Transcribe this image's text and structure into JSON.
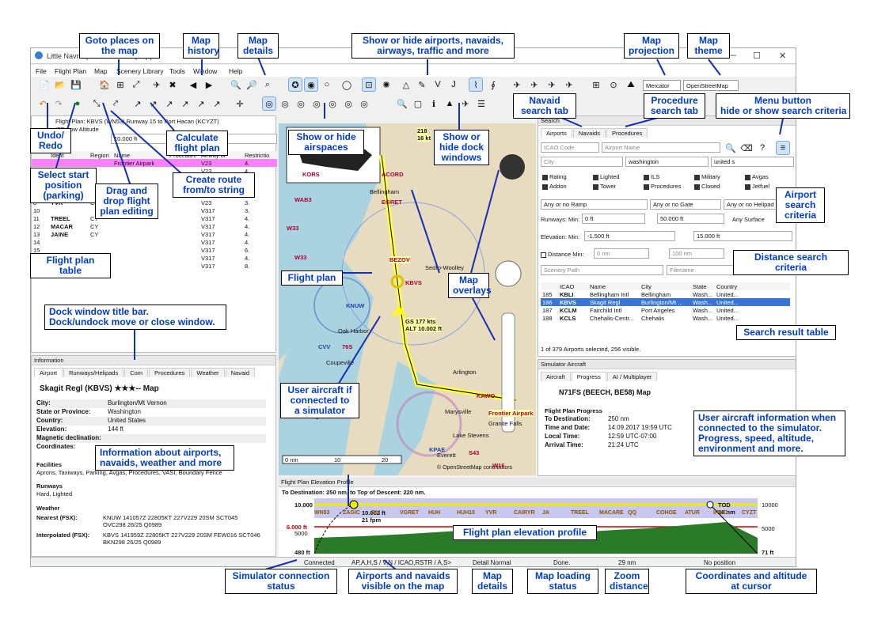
{
  "window": {
    "title": "Little Navmap ... Frontier ... (ZT).pln"
  },
  "menu": [
    "File",
    "Flight Plan",
    "Map",
    "Scenery Library",
    "Tools",
    "Window",
    "Help"
  ],
  "toolbar": {
    "projection": "Mercator",
    "theme": "OpenStreetMap"
  },
  "flightplan": {
    "header": "Flight Plan: KBVS (WN53) Runway 15 to Port Hacan (KCYZT)",
    "subheader": "IFR Low Altitude",
    "altitude": "10.000 ft",
    "columns": [
      "Ident",
      "Region",
      "Name",
      "Procedure",
      "Airway or",
      "Restrictio"
    ],
    "rows": [
      {
        "n": "4",
        "ident": "EGRET",
        "region": "K1",
        "name": "",
        "airway": "V23",
        "r": "4."
      },
      {
        "n": "5",
        "ident": "ACORD",
        "region": "K1",
        "name": "",
        "airway": "V23",
        "r": "3."
      },
      {
        "n": "6",
        "ident": "HUH",
        "region": "K1",
        "name": "Whatcom",
        "airway": "V23",
        "r": "3."
      },
      {
        "n": "7",
        "ident": "HUH10",
        "region": "CY",
        "name": "",
        "airway": "V23",
        "r": "3."
      },
      {
        "n": "8",
        "ident": "YVR",
        "region": "CY",
        "name": "",
        "airway": "V23",
        "r": "3."
      },
      {
        "n": "10",
        "ident": "",
        "region": "",
        "name": "",
        "airway": "V317",
        "r": "3."
      },
      {
        "n": "11",
        "ident": "TREEL",
        "region": "CY",
        "name": "",
        "airway": "V317",
        "r": "4."
      },
      {
        "n": "12",
        "ident": "MACAR",
        "region": "CY",
        "name": "",
        "airway": "V317",
        "r": "4."
      },
      {
        "n": "13",
        "ident": "JAINE",
        "region": "CY",
        "name": "",
        "airway": "V317",
        "r": "4."
      },
      {
        "n": "14",
        "ident": "",
        "region": "",
        "name": "",
        "airway": "V317",
        "r": "4."
      },
      {
        "n": "15",
        "ident": "",
        "region": "",
        "name": "",
        "airway": "V317",
        "r": "6."
      },
      {
        "n": "16",
        "ident": "",
        "region": "",
        "name": "",
        "airway": "V317",
        "r": "4."
      },
      {
        "n": "17",
        "ident": "FENEL",
        "region": "CY",
        "name": "",
        "airway": "V317",
        "r": "8."
      }
    ]
  },
  "info": {
    "title": "Information",
    "tabs": [
      "Airport",
      "Runways/Helipads",
      "Com",
      "Procedures",
      "Weather",
      "Navaid"
    ],
    "airport": "Skagit Regl (KBVS) ★★★-- Map",
    "fields": [
      {
        "k": "City:",
        "v": "Burlington/Mt Vernon"
      },
      {
        "k": "State or Province:",
        "v": "Washington"
      },
      {
        "k": "Country:",
        "v": "United States"
      },
      {
        "k": "Elevation:",
        "v": "144 ft"
      },
      {
        "k": "Magnetic declination:",
        "v": ""
      },
      {
        "k": "Coordinates:",
        "v": ""
      }
    ],
    "facilities_h": "Facilities",
    "facilities": "Aprons, Taxiways, Parking, Avgas, Procedures, VASI, Boundary Fence",
    "runways_h": "Runways",
    "runways": "Hard, Lighted",
    "weather_h": "Weather",
    "nearest_k": "Nearest (FSX):",
    "nearest": "KNUW 141057Z 22805KT 227V229 20SM SCT045 OVC298 26/25 Q0989",
    "interp_k": "Interpolated (FSX):",
    "interp": "KBVS 141959Z 22805KT 227V229 20SM FEW016 SCT046 BKN298 26/25 Q0989"
  },
  "search": {
    "title": "Search",
    "tabs": [
      "Airports",
      "Navaids",
      "Procedures"
    ],
    "icao_ph": "ICAO Code",
    "name_ph": "Airport Name",
    "city_ph": "City",
    "state": "washington",
    "country": "united s",
    "checks": [
      "Rating",
      "Lighted",
      "ILS",
      "Military",
      "Avgas",
      "Addon",
      "Tower",
      "Procedures",
      "Closed",
      "Jetfuel"
    ],
    "ramp": "Any or no Ramp",
    "gate": "Any or no Gate",
    "helipad": "Any or no Helipad",
    "rw_min": "0 ft",
    "rw_max": "50.000 ft",
    "surface": "Any Surface",
    "el_min": "-1.500 ft",
    "el_max": "15.000 ft",
    "dist_min": "0 nm",
    "dist_max": "100 nm",
    "scenery_ph": "Scenery Path",
    "file_ph": "Filename",
    "columns": [
      "ICAO",
      "Name",
      "City",
      "State",
      "Country"
    ],
    "results": [
      {
        "n": "185",
        "icao": "KBLI",
        "name": "Bellingham Intl",
        "city": "Bellingham",
        "state": "Wash...",
        "country": "United..."
      },
      {
        "n": "186",
        "icao": "KBVS",
        "name": "Skagit Regl",
        "city": "Burlington/Mt ...",
        "state": "Wash...",
        "country": "United..."
      },
      {
        "n": "187",
        "icao": "KCLM",
        "name": "Fairchild Intl",
        "city": "Port Angeles",
        "state": "Wash...",
        "country": "United..."
      },
      {
        "n": "188",
        "icao": "KCLS",
        "name": "Chehalis-Centr...",
        "city": "Chehalis",
        "state": "Wash...",
        "country": "United..."
      }
    ],
    "count": "1 of 379 Airports selected, 256 visible."
  },
  "sim": {
    "title": "Simulator Aircraft",
    "tabs": [
      "Aircraft",
      "Progress",
      "AI / Multiplayer"
    ],
    "aircraft": "N71FS (BEECH, BE58) Map",
    "heading": "Flight Plan Progress",
    "fields": [
      {
        "k": "To Destination:",
        "v": "250 nm"
      },
      {
        "k": "Time and Date:",
        "v": "14.09.2017 19:59 UTC"
      },
      {
        "k": "Local Time:",
        "v": "12:59 UTC-07:00"
      },
      {
        "k": "Arrival Time:",
        "v": "21:24 UTC"
      }
    ]
  },
  "elevation": {
    "title": "Flight Plan Elevation Profile",
    "summary": "To Destination: 250 nm, to Top of Descent: 220 nm.",
    "alt_top": "10.000",
    "alt_red": "6.000 ft",
    "alt_5000": "5000",
    "alt_bottom": "480 ft",
    "alt_right": "71 ft",
    "alt_right_top": "10000",
    "alt_right_mid": "5000",
    "aircraft": "10.002 ft\n21 fpm",
    "tod": "TOD\n30 nm",
    "waypoints": [
      "WN53",
      "ZAGIC",
      "BLI",
      "VGRET",
      "HUH",
      "HUH10",
      "YVR",
      "CAIRYR",
      "JA",
      "TREEL",
      "MACARE",
      "QQ",
      "COHOE",
      "ATUR",
      "IRMO",
      "CYZT"
    ]
  },
  "map": {
    "scale": [
      "0 nm",
      "10",
      "20"
    ],
    "credit": "© OpenStreetMap contributors",
    "labels": [
      "KORS",
      "WAB3",
      "W33",
      "W33",
      "KBVS",
      "KNUW",
      "CVV",
      "76S",
      "KPAE",
      "S43",
      "W16",
      "KAWO",
      "BEZOV",
      "EGRET",
      "ACORD",
      "GS 177 kts",
      "ALT 10.002 ft",
      "Frontier Airpark",
      "Bellingham",
      "Sedro-Woolley",
      "Oak Harbor",
      "Coupeville",
      "Everett",
      "Arlington",
      "Marysville",
      "Lake Stevens",
      "Granite Falls",
      "218",
      "16 kt"
    ]
  },
  "status": {
    "connected": "Connected",
    "visible": "AP,A,H,S / V,N / ICAO,RSTR / A,S>",
    "detail": "Detail Normal",
    "loading": "Done.",
    "zoom": "29 nm",
    "pos": "No position"
  },
  "annotations": {
    "goto": "Goto places on\nthe map",
    "history": "Map\nhistory",
    "details": "Map\ndetails",
    "showhide": "Show or hide airports, navaids,\nairways, traffic and more",
    "projection": "Map\nprojection",
    "theme": "Map\ntheme",
    "navaidtab": "Navaid\nsearch tab",
    "proctab": "Procedure\nsearch tab",
    "menubtn": "Menu button\nhide or show search criteria",
    "undo": "Undo/\nRedo",
    "calc": "Calculate\nflight plan",
    "airspaces": "Show or hide\nairspaces",
    "dock": "Show or\nhide dock\nwindows",
    "start": "Select start\nposition\n(parking)",
    "drag": "Drag and\ndrop flight\nplan editing",
    "route": "Create route\nfrom/to string",
    "aptcrit": "Airport\nsearch\ncriteria",
    "distcrit": "Distance search criteria",
    "fptable": "Flight plan table",
    "flightplan": "Flight plan",
    "overlays": "Map\noverlays",
    "dockbar": "Dock window title bar.\nDock/undock move or close window.",
    "result": "Search result table",
    "infoabout": "Information about airports,\nnavaids, weather and more",
    "useraircraft": "User aircraft if\nconnected to\na simulator",
    "userinfo": "User aircraft information when\nconnected to the simulator.\nProgress, speed, altitude,\nenvironment and more.",
    "elevprofile": "Flight plan elevation profile",
    "simstatus": "Simulator connection\nstatus",
    "visible": "Airports and navaids\nvisible on the map",
    "mapdetails": "Map\ndetails",
    "loadstatus": "Map loading\nstatus",
    "zoomdist": "Zoom\ndistance",
    "coords": "Coordinates and altitude\nat cursor"
  }
}
